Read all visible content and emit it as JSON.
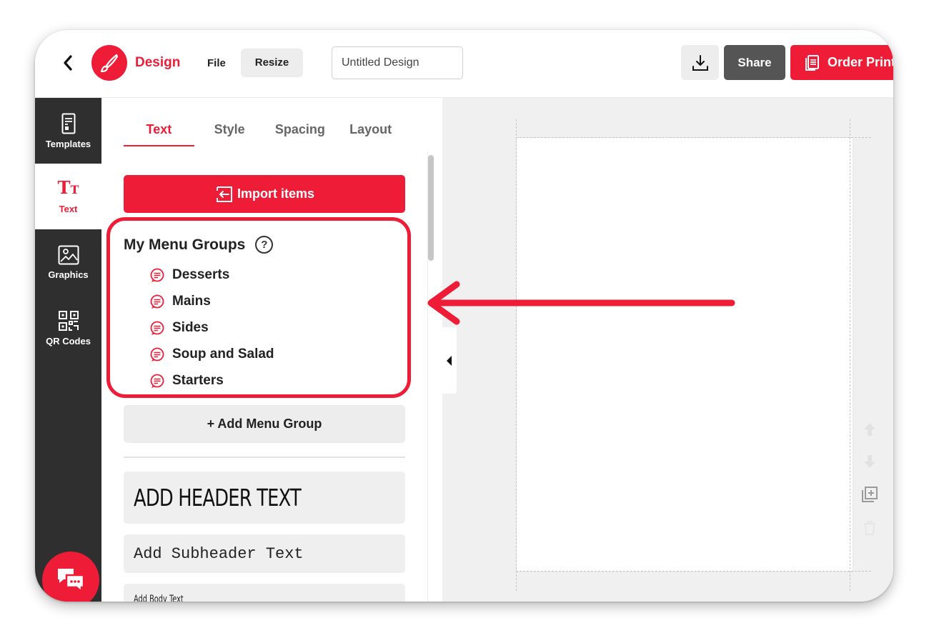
{
  "app": {
    "brand": "Design",
    "accent_color": "#ee1c37"
  },
  "topbar": {
    "back_icon": "chevron-left-icon",
    "logo_icon": "paintbrush-icon",
    "file_label": "File",
    "resize_label": "Resize",
    "title_value": "Untitled Design",
    "download_icon": "download-icon",
    "share_label": "Share",
    "order_label": "Order Print",
    "order_icon": "print-document-icon"
  },
  "rail": {
    "items": [
      {
        "label": "Templates",
        "icon": "templates-icon"
      },
      {
        "label": "Text",
        "icon": "text-icon",
        "glyph": "TT",
        "active": true
      },
      {
        "label": "Graphics",
        "icon": "image-icon"
      },
      {
        "label": "QR Codes",
        "icon": "qr-code-icon"
      }
    ],
    "chat_icon": "chat-bubbles-icon"
  },
  "panel": {
    "tabs": [
      "Text",
      "Style",
      "Spacing",
      "Layout"
    ],
    "active_tab": "Text",
    "import_label": "Import items",
    "import_icon": "import-arrow-icon",
    "groups_title": "My Menu Groups",
    "help_glyph": "?",
    "groups": [
      "Desserts",
      "Mains",
      "Sides",
      "Soup and Salad",
      "Starters"
    ],
    "group_icon": "menu-group-icon",
    "add_group_label": "+ Add Menu Group",
    "header_text": "ADD HEADER TEXT",
    "subheader_text": "Add Subheader Text",
    "body_text": "Add Body Text"
  },
  "canvas": {
    "tools": [
      "move-up-icon",
      "move-down-icon",
      "duplicate-icon",
      "delete-icon"
    ]
  }
}
